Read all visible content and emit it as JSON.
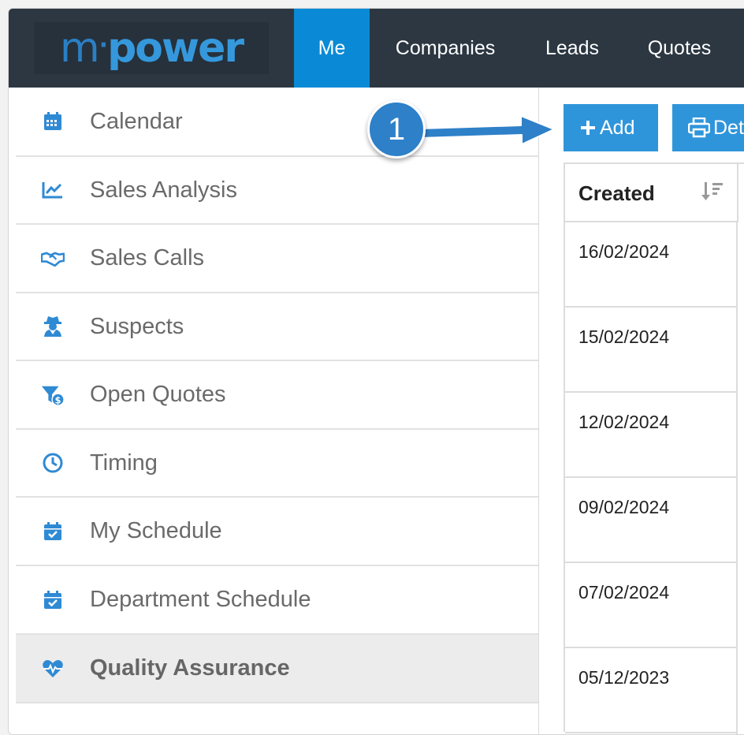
{
  "nav": {
    "logo_left": "m",
    "logo_dot": "·",
    "logo_right": "power",
    "tabs": [
      {
        "label": "Me",
        "active": true
      },
      {
        "label": "Companies"
      },
      {
        "label": "Leads"
      },
      {
        "label": "Quotes"
      }
    ]
  },
  "sidebar": {
    "items": [
      {
        "label": "Calendar",
        "icon": "calendar-icon"
      },
      {
        "label": "Sales Analysis",
        "icon": "chart-line-icon"
      },
      {
        "label": "Sales Calls",
        "icon": "handshake-icon"
      },
      {
        "label": "Suspects",
        "icon": "user-secret-icon"
      },
      {
        "label": "Open Quotes",
        "icon": "funnel-dollar-icon"
      },
      {
        "label": "Timing",
        "icon": "clock-icon"
      },
      {
        "label": "My Schedule",
        "icon": "calendar-check-icon"
      },
      {
        "label": "Department Schedule",
        "icon": "calendar-check-icon"
      },
      {
        "label": "Quality Assurance",
        "icon": "heartbeat-icon",
        "active": true
      }
    ]
  },
  "toolbar": {
    "add_label": "Add",
    "add_icon": "plus-icon",
    "print_label": "Det",
    "print_icon": "print-icon"
  },
  "table": {
    "columns": [
      {
        "label": "Created",
        "sort_icon": "sort-amount-down-icon"
      }
    ],
    "rows": [
      "16/02/2024",
      "15/02/2024",
      "12/02/2024",
      "09/02/2024",
      "07/02/2024",
      "05/12/2023"
    ]
  },
  "callout": {
    "number": "1"
  },
  "colors": {
    "nav_bg": "#2c3742",
    "active_tab": "#0a8ad6",
    "button": "#2f95db",
    "icon_blue": "#2f8ad4",
    "callout": "#2e80c8"
  }
}
